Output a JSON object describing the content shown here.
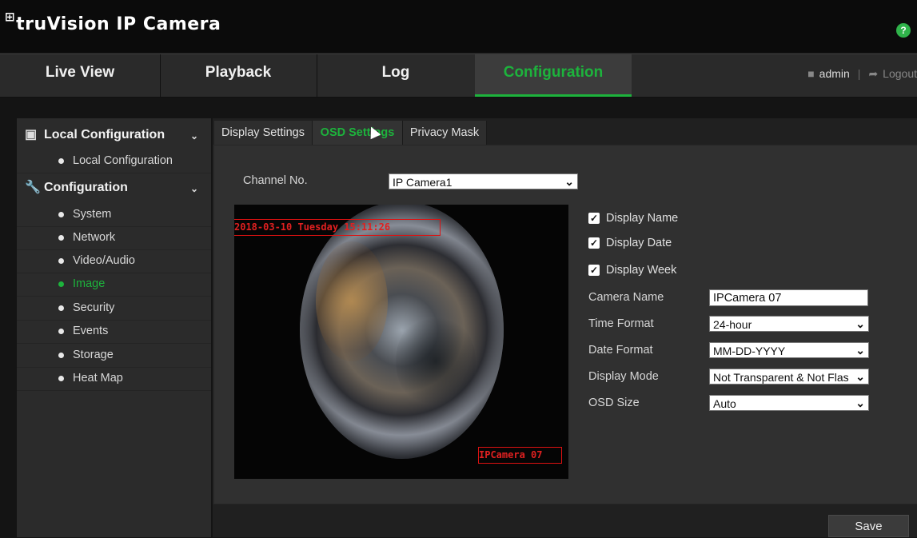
{
  "app": {
    "logo_glyph": "⊞",
    "title": "truVision IP Camera",
    "help_label": "?"
  },
  "nav": {
    "tabs": [
      "Live View",
      "Playback",
      "Log",
      "Configuration"
    ],
    "active": "Configuration",
    "user": "admin",
    "logout": "Logout"
  },
  "sidebar": {
    "local_header": "Local Configuration",
    "local_items": [
      "Local Configuration"
    ],
    "config_header": "Configuration",
    "config_items": [
      "System",
      "Network",
      "Video/Audio",
      "Image",
      "Security",
      "Events",
      "Storage",
      "Heat Map"
    ],
    "active_item": "Image"
  },
  "subtabs": {
    "items": [
      "Display Settings",
      "OSD Settings",
      "Privacy Mask"
    ],
    "active": "OSD Settings"
  },
  "form": {
    "channel_label": "Channel No.",
    "channel_value": "IP Camera1",
    "display_name_label": "Display Name",
    "display_name_checked": true,
    "display_date_label": "Display Date",
    "display_date_checked": true,
    "display_week_label": "Display Week",
    "display_week_checked": true,
    "camera_name_label": "Camera Name",
    "camera_name_value": "IPCamera 07",
    "time_format_label": "Time Format",
    "time_format_value": "24-hour",
    "date_format_label": "Date Format",
    "date_format_value": "MM-DD-YYYY",
    "display_mode_label": "Display Mode",
    "display_mode_value": "Not Transparent & Not Flas",
    "osd_size_label": "OSD Size",
    "osd_size_value": "Auto"
  },
  "preview": {
    "osd_datetime_text": "2018-03-10 Tuesday 15:11:26",
    "osd_camera_name_text": "IPCamera 07"
  },
  "footer": {
    "save_label": "Save"
  },
  "colors": {
    "accent": "#1db33c",
    "osd_red": "#e02020",
    "background": "#141414"
  },
  "icons": {
    "local_config": "monitor-icon",
    "configuration": "wrench-icon",
    "user": "user-icon",
    "logout": "logout-icon",
    "help": "help-icon",
    "chevron": "chevron-down-icon",
    "cursor": "mouse-cursor-icon"
  }
}
